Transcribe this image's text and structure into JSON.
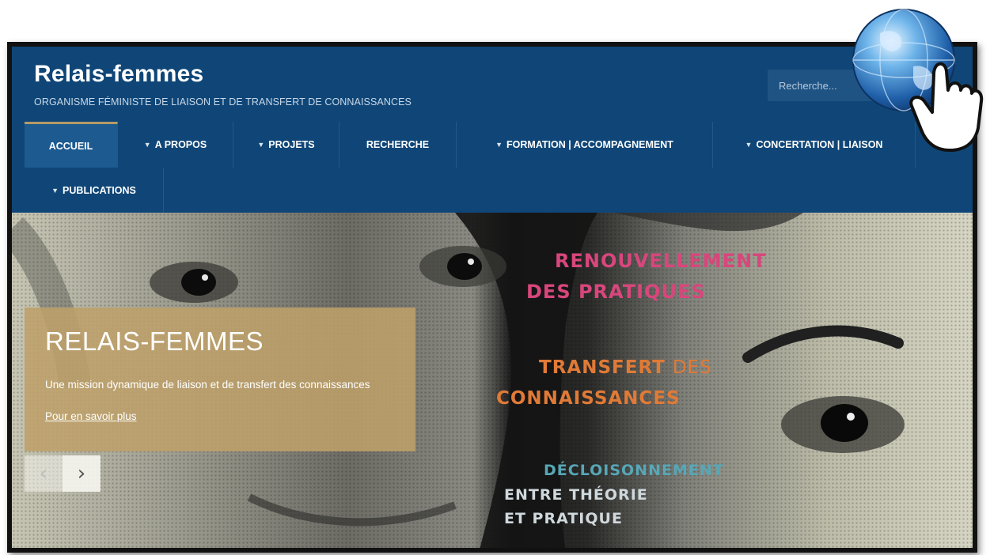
{
  "header": {
    "title": "Relais-femmes",
    "tagline": "ORGANISME FÉMINISTE DE LIAISON ET DE TRANSFERT DE CONNAISSANCES",
    "search_placeholder": "Recherche..."
  },
  "nav": {
    "items": [
      {
        "label": "ACCUEIL",
        "has_caret": false,
        "active": true
      },
      {
        "label": "A PROPOS",
        "has_caret": true,
        "active": false
      },
      {
        "label": "PROJETS",
        "has_caret": true,
        "active": false
      },
      {
        "label": "RECHERCHE",
        "has_caret": false,
        "active": false
      },
      {
        "label": "FORMATION | ACCOMPAGNEMENT",
        "has_caret": true,
        "active": false
      },
      {
        "label": "CONCERTATION | LIAISON",
        "has_caret": true,
        "active": false
      },
      {
        "label": "PUBLICATIONS",
        "has_caret": true,
        "active": false
      }
    ]
  },
  "hero": {
    "slogans": {
      "renouvellement": "RENOUVELLEMENT",
      "des_pratiques": "DES PRATIQUES",
      "transfert": "TRANSFERT",
      "des": "DES",
      "connaissances": "CONNAISSANCES",
      "decloisonnement": "DÉCLOISONNEMENT",
      "entre_theorie": "ENTRE THÉORIE",
      "et_pratique": "ET PRATIQUE"
    },
    "caption": {
      "title": "RELAIS-FEMMES",
      "text": "Une mission dynamique de liaison et de transfert des connaissances",
      "link": "Pour en savoir plus"
    },
    "controls": {
      "prev_symbol": "‹",
      "next_symbol": "›"
    }
  },
  "colors": {
    "header_bg": "#0f4677",
    "accent_gold": "#b59a64",
    "slogan_pink": "#d8467c",
    "slogan_orange": "#e07a37",
    "slogan_teal": "#57a7b7"
  },
  "icons": {
    "overlay": "globe-with-pointing-hand-icon"
  }
}
